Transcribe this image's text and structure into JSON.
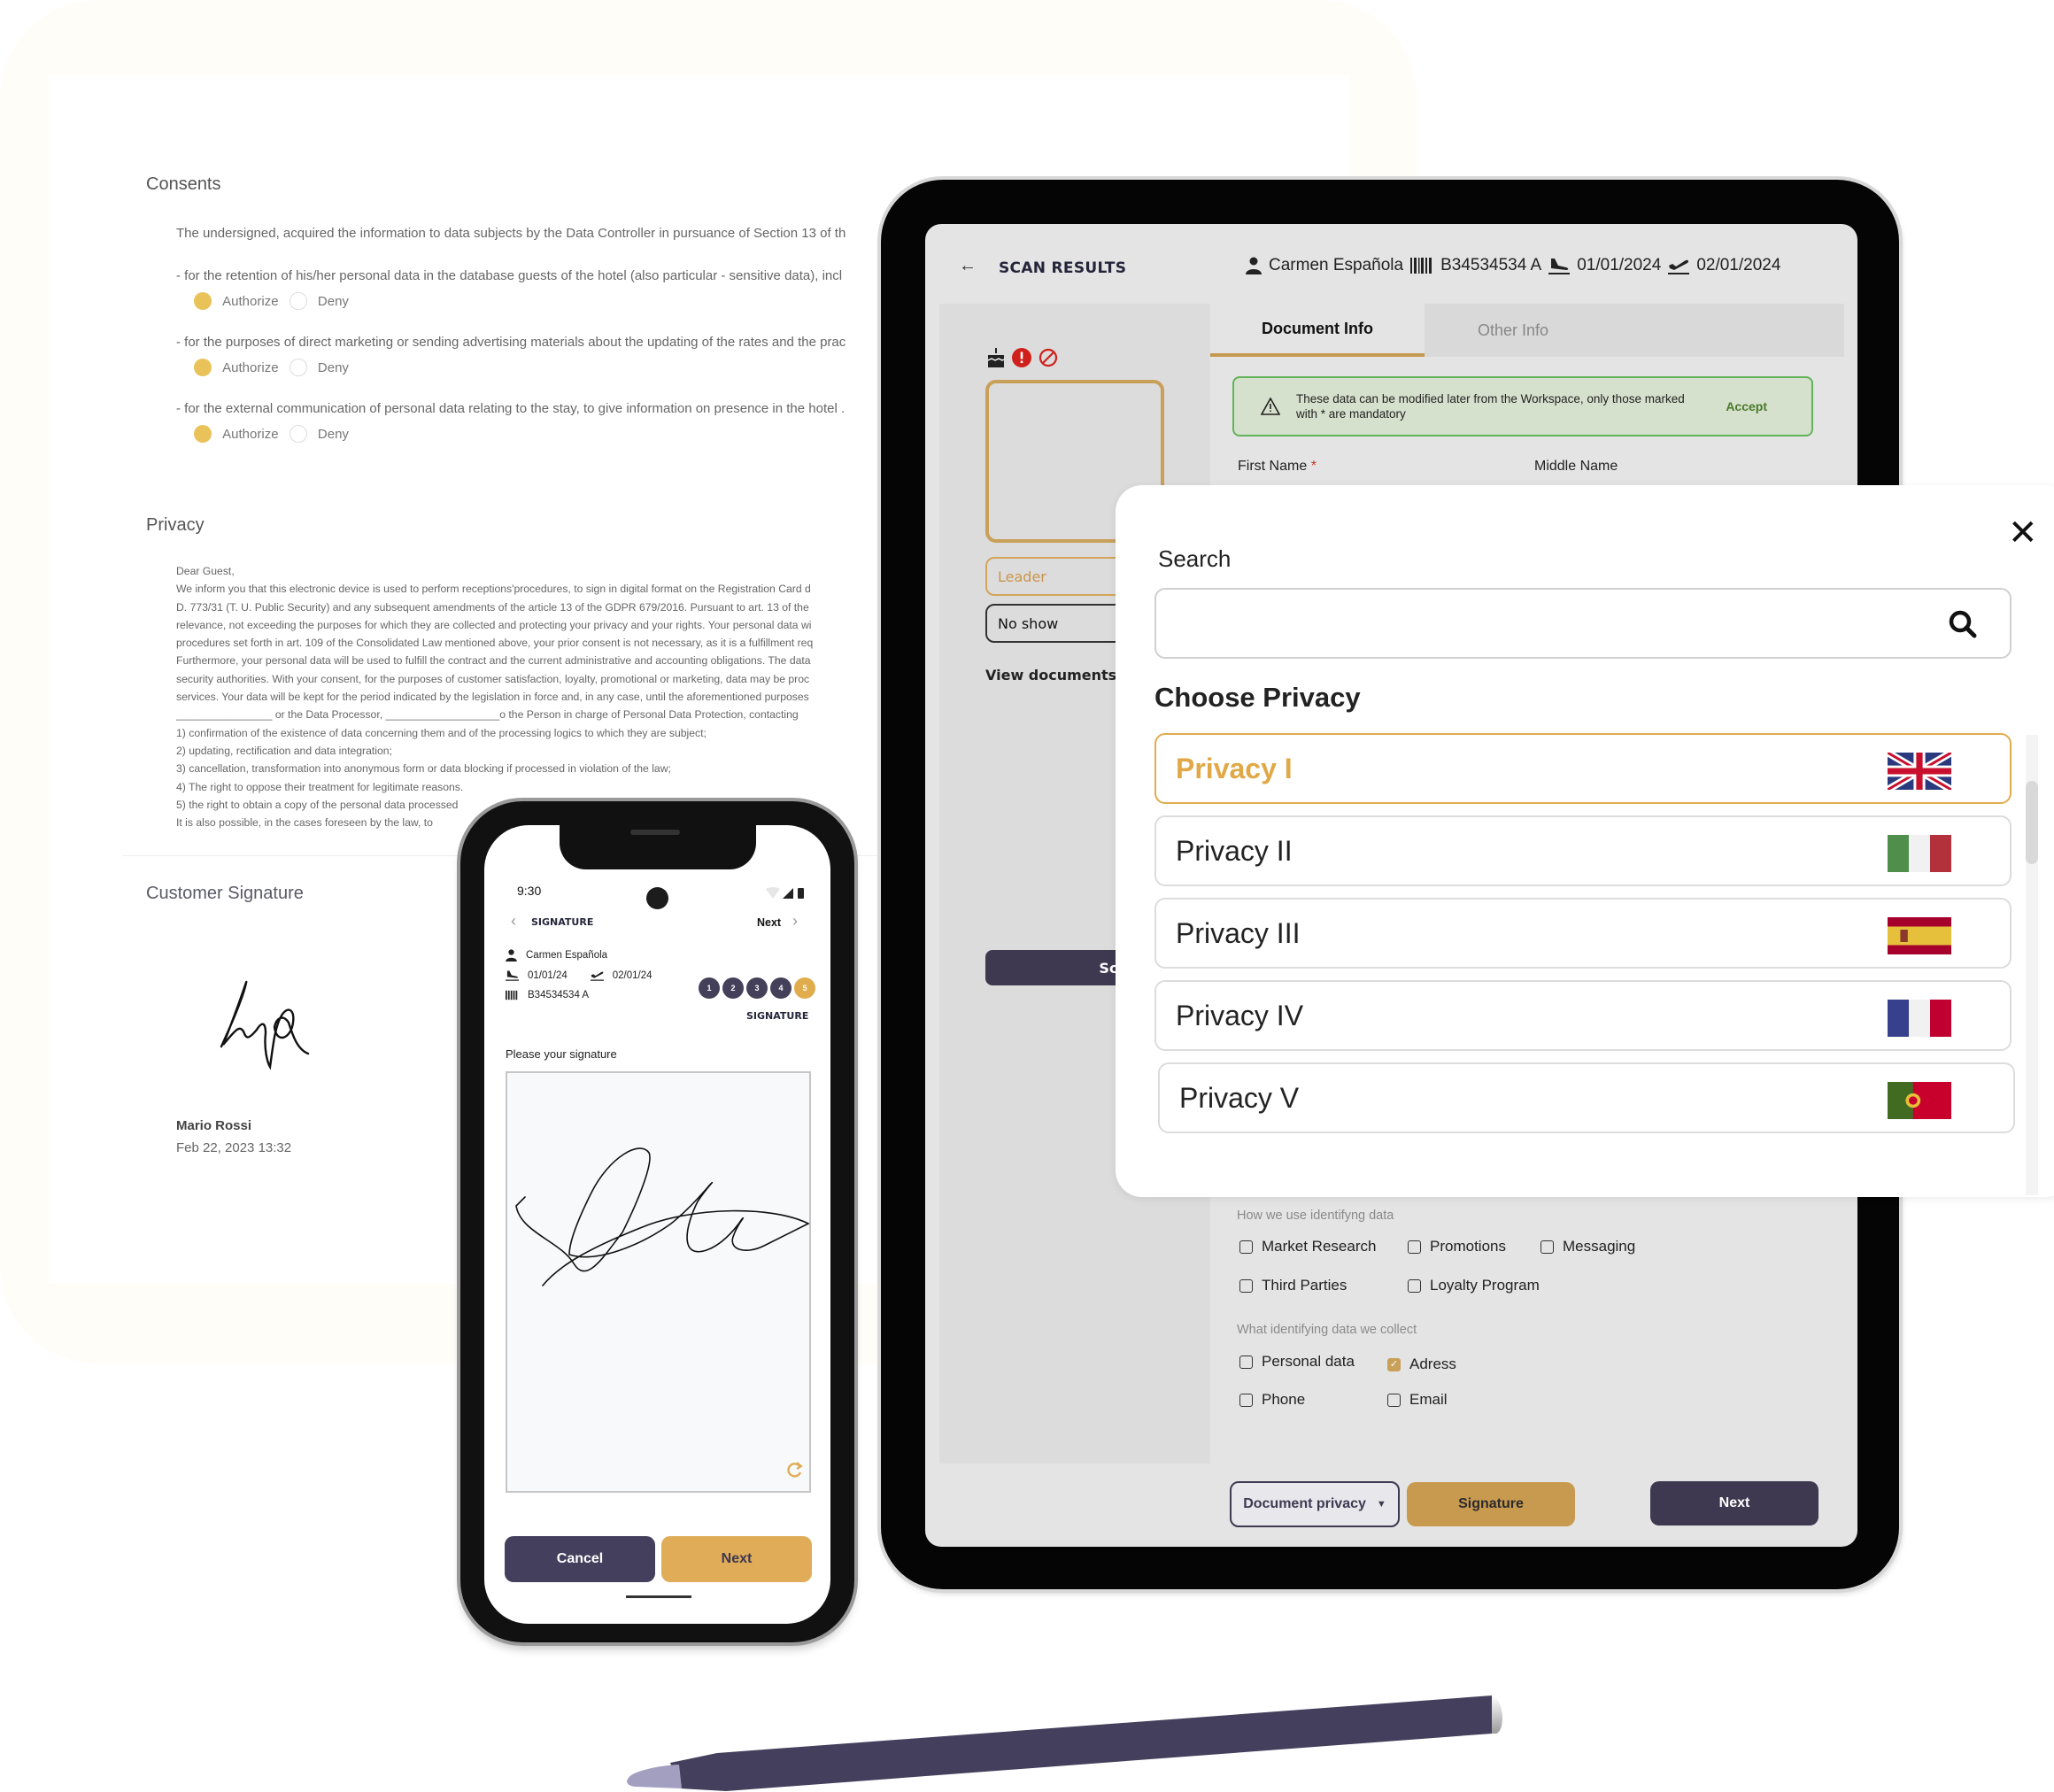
{
  "document": {
    "consents_title": "Consents",
    "consents_intro": "The undersigned, acquired the information to data subjects by the Data Controller in pursuance of Section 13 of th",
    "consent_items": [
      {
        "text": "- for the retention of his/her personal data in the database guests of the hotel (also particular - sensitive data), incl",
        "authorize": "Authorize",
        "deny": "Deny",
        "selected": "authorize"
      },
      {
        "text": "- for the purposes of direct marketing or sending advertising materials about the updating of the rates and the prac",
        "authorize": "Authorize",
        "deny": "Deny",
        "selected": "authorize"
      },
      {
        "text": "- for the external communication of personal data relating to the stay, to give information on presence in the hotel .",
        "authorize": "Authorize",
        "deny": "Deny",
        "selected": "authorize"
      }
    ],
    "privacy_title": "Privacy",
    "privacy_lines": [
      "Dear Guest,",
      "We inform you that this electronic device is used to perform receptions'procedures, to sign in digital format on the Registration Card d",
      "D. 773/31 (T. U. Public Security) and any subsequent amendments of the article 13 of the GDPR 679/2016. Pursuant to art. 13 of the",
      "relevance, not exceeding the purposes for which they are collected and protecting your privacy and your rights. Your personal data wi",
      "procedures set forth in art. 109 of the Consolidated Law mentioned above, your prior consent is not necessary, as it is a fulfillment req",
      "Furthermore, your personal data will be used to fulfill the contract and the current administrative and accounting obligations. The data",
      "security authorities. With your consent, for the purposes of customer satisfaction, loyalty, promotional or marketing, data may be proc",
      "services. Your data will be kept for the period indicated by the legislation in force and, in any case, until the aforementioned purposes",
      "________________ or the Data Processor, ___________________o the Person in charge of Personal Data Protection, contacting",
      "1) confirmation of the existence of data concerning them and of the processing logics to which they are subject;",
      "2) updating, rectification and data integration;",
      "3) cancellation, transformation into anonymous form or data blocking if processed in violation of the law;",
      "4) The right to oppose their treatment for legitimate reasons.",
      "5) the right to obtain a copy of the personal data processed",
      "It is also possible, in the cases foreseen by the law, to"
    ],
    "signature_title": "Customer Signature",
    "signer_name": "Mario Rossi",
    "signed_at": "Feb 22, 2023 13:32"
  },
  "tablet": {
    "header": {
      "back_icon": "arrow-left-icon",
      "title": "SCAN RESULTS",
      "guest_name": "Carmen Española",
      "document_number": "B34534534  A",
      "arrival_date": "01/01/2024",
      "departure_date": "02/01/2024"
    },
    "tabs": [
      {
        "label": "Document Info",
        "active": true
      },
      {
        "label": "Other Info",
        "active": false
      }
    ],
    "alert": {
      "message": "These data can be modified later from the Workspace, only those marked with * are mandatory",
      "action": "Accept"
    },
    "fields": [
      {
        "label": "First Name",
        "required": true
      },
      {
        "label": "Middle Name",
        "required": false
      }
    ],
    "left_pane": {
      "status_icons": [
        "birthday-cake-icon",
        "alert-icon",
        "blocked-icon"
      ],
      "leader_label": "Leader",
      "no_show_label": "No show",
      "view_documents": "View documents",
      "scan_button": "Scan"
    },
    "how_we_use": {
      "label": "How we use identifyng data",
      "options": [
        {
          "label": "Market Research",
          "checked": false
        },
        {
          "label": "Promotions",
          "checked": false
        },
        {
          "label": "Messaging",
          "checked": false
        },
        {
          "label": "Third Parties",
          "checked": false
        },
        {
          "label": "Loyalty Program",
          "checked": false
        }
      ]
    },
    "what_we_collect": {
      "label": "What identifying data we collect",
      "options": [
        {
          "label": "Personal data",
          "checked": false
        },
        {
          "label": "Adress",
          "checked": true
        },
        {
          "label": "Phone",
          "checked": false
        },
        {
          "label": "Email",
          "checked": false
        }
      ]
    },
    "footer": {
      "document_privacy": "Document privacy",
      "signature": "Signature",
      "next": "Next"
    }
  },
  "modal": {
    "search_label": "Search",
    "search_value": "",
    "search_placeholder": "",
    "choose_title": "Choose Privacy",
    "items": [
      {
        "label": "Privacy I",
        "flag": "uk-flag-icon",
        "selected": true
      },
      {
        "label": "Privacy II",
        "flag": "italy-flag-icon",
        "selected": false
      },
      {
        "label": "Privacy III",
        "flag": "spain-flag-icon",
        "selected": false
      },
      {
        "label": "Privacy IV",
        "flag": "france-flag-icon",
        "selected": false
      },
      {
        "label": "Privacy V",
        "flag": "portugal-flag-icon",
        "selected": false
      }
    ]
  },
  "phone": {
    "status_time": "9:30",
    "title": "SIGNATURE",
    "next_label": "Next",
    "guest_name": "Carmen Española",
    "arrival_date": "01/01/24",
    "departure_date": "02/01/24",
    "document_number": "B34534534  A",
    "steps": [
      "1",
      "2",
      "3",
      "4",
      "5"
    ],
    "current_step": 5,
    "step_label": "SIGNATURE",
    "prompt": "Please your signature",
    "cancel_button": "Cancel",
    "next_button": "Next"
  },
  "colors": {
    "gold": "#c89a50",
    "gold_light": "#e0ac4e",
    "navy": "#3e3951",
    "alert_green": "#62b35a",
    "alert_bg": "#d6e1cd"
  }
}
